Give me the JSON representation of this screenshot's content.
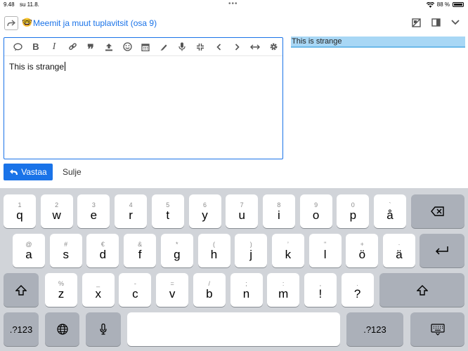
{
  "status": {
    "time": "9.48",
    "date": "su 11.8.",
    "dots": "•••",
    "battery_text": "88 %",
    "battery_level": 0.88
  },
  "header": {
    "reply_icon": "reply-arrow-icon",
    "emoji": "🤓",
    "topic_title": "Meemit ja muut tuplavitsit (osa 9)",
    "icons": [
      "hide-preview-icon",
      "side-panel-icon",
      "collapse-chevron-icon"
    ]
  },
  "toolbar": {
    "buttons": [
      "speech-bubble-icon",
      "bold-icon",
      "italic-icon",
      "link-icon",
      "quote-icon",
      "upload-icon",
      "emoji-icon",
      "calendar-icon",
      "highlighter-icon",
      "microphone-icon",
      "minimize-icon",
      "chevron-left-icon",
      "chevron-right-icon",
      "horizontal-arrows-icon",
      "gear-icon"
    ],
    "labels": {
      "bold": "B",
      "italic": "I",
      "quote": "❞"
    }
  },
  "editor": {
    "text": "This is strange"
  },
  "preview": {
    "text": "This is strange"
  },
  "actions": {
    "reply_label": "Vastaa",
    "close_label": "Sulje"
  },
  "keyboard": {
    "row1": [
      {
        "k": "q",
        "s": "1"
      },
      {
        "k": "w",
        "s": "2"
      },
      {
        "k": "e",
        "s": "3"
      },
      {
        "k": "r",
        "s": "4"
      },
      {
        "k": "t",
        "s": "5"
      },
      {
        "k": "y",
        "s": "6"
      },
      {
        "k": "u",
        "s": "7"
      },
      {
        "k": "i",
        "s": "8"
      },
      {
        "k": "o",
        "s": "9"
      },
      {
        "k": "p",
        "s": "0"
      },
      {
        "k": "å",
        "s": "`"
      }
    ],
    "row2": [
      {
        "k": "a",
        "s": "@"
      },
      {
        "k": "s",
        "s": "#"
      },
      {
        "k": "d",
        "s": "€"
      },
      {
        "k": "f",
        "s": "&"
      },
      {
        "k": "g",
        "s": "*"
      },
      {
        "k": "h",
        "s": "("
      },
      {
        "k": "j",
        "s": ")"
      },
      {
        "k": "k",
        "s": "’"
      },
      {
        "k": "l",
        "s": "\""
      },
      {
        "k": "ö",
        "s": "+"
      },
      {
        "k": "ä",
        "s": "·"
      }
    ],
    "row3": [
      {
        "k": "z",
        "s": "%"
      },
      {
        "k": "x",
        "s": "_"
      },
      {
        "k": "c",
        "s": "-"
      },
      {
        "k": "v",
        "s": "="
      },
      {
        "k": "b",
        "s": "/"
      },
      {
        "k": "n",
        "s": ";"
      },
      {
        "k": "m",
        "s": ":"
      },
      {
        "k": "!",
        "s": ","
      },
      {
        "k": "?",
        "s": "."
      }
    ],
    "numbers_label": ".?123",
    "space_label": ""
  }
}
